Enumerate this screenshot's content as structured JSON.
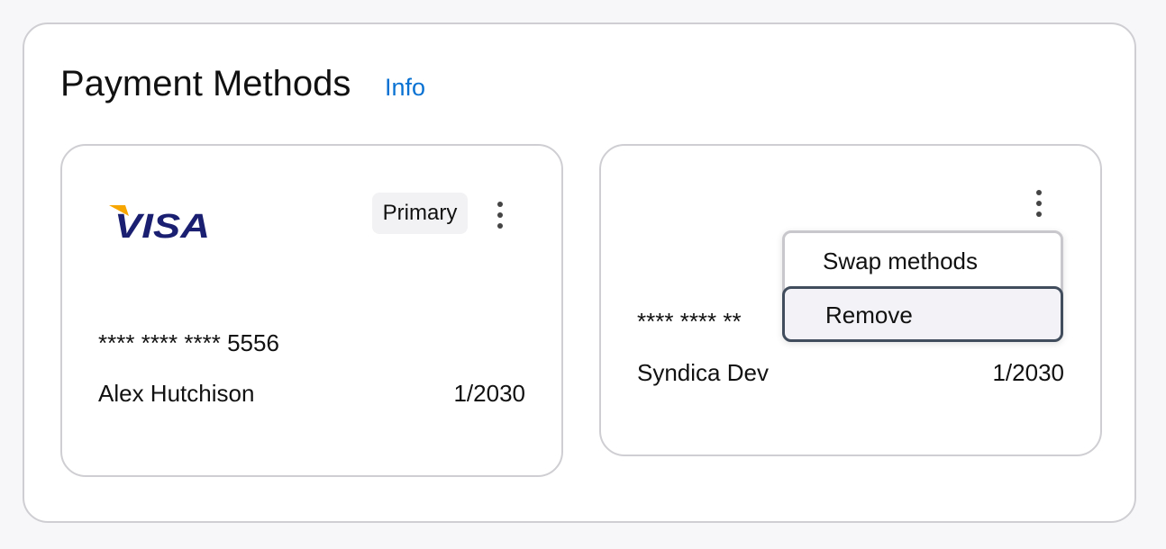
{
  "section": {
    "title": "Payment Methods",
    "info_link": "Info"
  },
  "cards": [
    {
      "brand": "VISA",
      "badge": "Primary",
      "number": "**** **** **** 5556",
      "holder": "Alex Hutchison",
      "expiry": "1/2030"
    },
    {
      "number": "**** **** **",
      "holder": "Syndica Dev",
      "expiry": "1/2030"
    }
  ],
  "menu": {
    "items": [
      "Swap methods",
      "Remove"
    ],
    "focused": "Remove"
  },
  "colors": {
    "link": "#0972d3",
    "visa_blue": "#1a1f71",
    "visa_gold": "#f7a600",
    "focus_border": "#414d5c"
  },
  "icons": {
    "card_actions": "kebab-menu-icon"
  }
}
